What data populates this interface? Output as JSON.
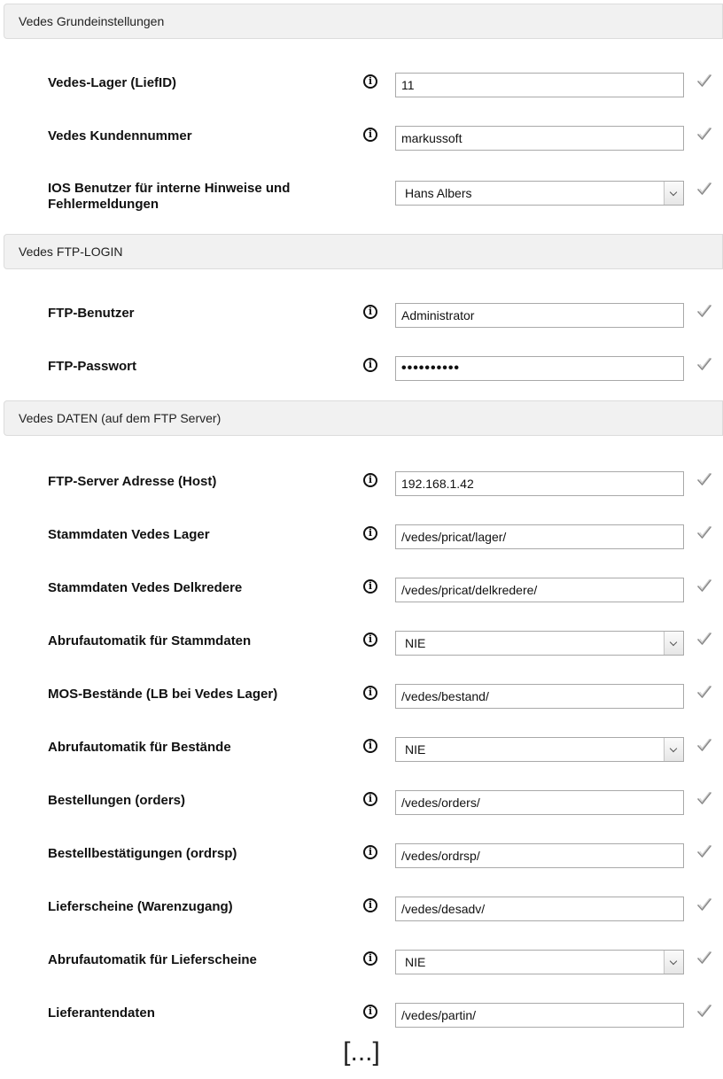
{
  "sections": [
    {
      "title": "Vedes Grundeinstellungen",
      "fields": [
        {
          "label": "Vedes-Lager (LiefID)",
          "value": "11",
          "type": "text",
          "info": true
        },
        {
          "label": "Vedes Kundennummer",
          "value": "markussoft",
          "type": "text",
          "info": true
        },
        {
          "label": "IOS Benutzer für interne Hinweise und Fehlermeldungen",
          "value": "Hans Albers",
          "type": "select",
          "info": false
        }
      ]
    },
    {
      "title": "Vedes FTP-LOGIN",
      "fields": [
        {
          "label": "FTP-Benutzer",
          "value": "Administrator",
          "type": "text",
          "info": true
        },
        {
          "label": "FTP-Passwort",
          "value": "••••••••••",
          "type": "password",
          "info": true
        }
      ]
    },
    {
      "title": "Vedes DATEN (auf dem FTP Server)",
      "fields": [
        {
          "label": "FTP-Server Adresse (Host)",
          "value": "192.168.1.42",
          "type": "text",
          "info": true
        },
        {
          "label": "Stammdaten Vedes Lager",
          "value": "/vedes/pricat/lager/",
          "type": "text",
          "info": true
        },
        {
          "label": "Stammdaten Vedes Delkredere",
          "value": "/vedes/pricat/delkredere/",
          "type": "text",
          "info": true
        },
        {
          "label": "Abrufautomatik für Stammdaten",
          "value": "NIE",
          "type": "select",
          "info": true
        },
        {
          "label": "MOS-Bestände (LB bei Vedes Lager)",
          "value": "/vedes/bestand/",
          "type": "text",
          "info": true
        },
        {
          "label": "Abrufautomatik für Bestände",
          "value": "NIE",
          "type": "select",
          "info": true
        },
        {
          "label": "Bestellungen (orders)",
          "value": "/vedes/orders/",
          "type": "text",
          "info": true
        },
        {
          "label": "Bestellbestätigungen (ordrsp)",
          "value": "/vedes/ordrsp/",
          "type": "text",
          "info": true
        },
        {
          "label": "Lieferscheine (Warenzugang)",
          "value": "/vedes/desadv/",
          "type": "text",
          "info": true
        },
        {
          "label": "Abrufautomatik für Lieferscheine",
          "value": "NIE",
          "type": "select",
          "info": true
        },
        {
          "label": "Lieferantendaten",
          "value": "/vedes/partin/",
          "type": "text",
          "info": true
        }
      ]
    }
  ],
  "icons": {
    "info": "info-circle-icon",
    "confirm": "checkmark-icon",
    "dropdown": "chevron-down-icon"
  },
  "info_glyph": "i",
  "ellipsis": "[...]"
}
